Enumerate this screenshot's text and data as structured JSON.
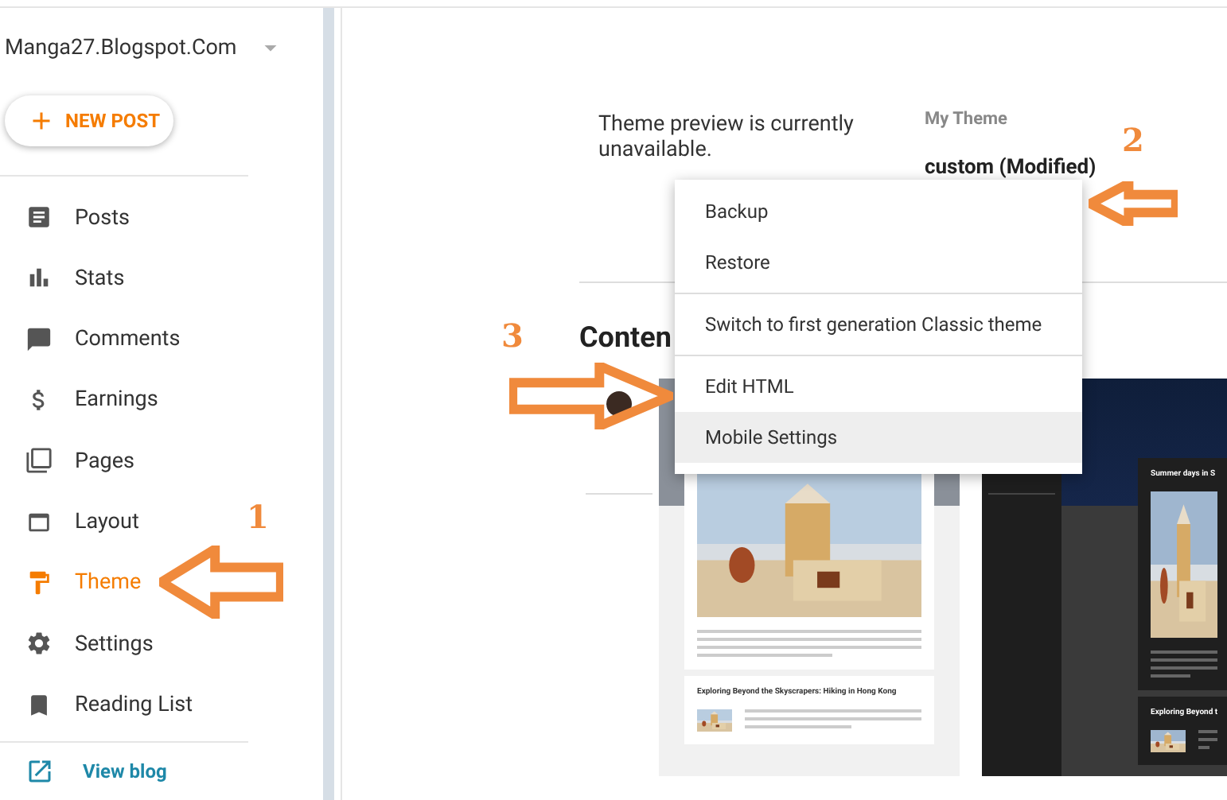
{
  "sidebar": {
    "blog_title": "Manga27.Blogspot.Com",
    "new_post": "NEW POST",
    "items": [
      {
        "label": "Posts",
        "selected": false
      },
      {
        "label": "Stats",
        "selected": false
      },
      {
        "label": "Comments",
        "selected": false
      },
      {
        "label": "Earnings",
        "selected": false
      },
      {
        "label": "Pages",
        "selected": false
      },
      {
        "label": "Layout",
        "selected": false
      },
      {
        "label": "Theme",
        "selected": true
      },
      {
        "label": "Settings",
        "selected": false
      },
      {
        "label": "Reading List",
        "selected": false
      }
    ],
    "view_blog": "View blog"
  },
  "main": {
    "preview_message": "Theme preview is currently unavailable.",
    "my_theme_label": "My Theme",
    "theme_name": "custom (Modified)",
    "section_heading": "Conten",
    "previews": [
      {
        "kind": "light",
        "headings": [
          "Exploring Beyond the Skyscrapers: Hiking in Hong Kong"
        ]
      },
      {
        "kind": "dark",
        "headings": [
          "Summer days in S",
          "Exploring Beyond t"
        ]
      }
    ]
  },
  "menu": {
    "groups": [
      [
        {
          "label": "Backup",
          "highlighted": false
        },
        {
          "label": "Restore",
          "highlighted": false
        }
      ],
      [
        {
          "label": "Switch to first generation Classic theme",
          "highlighted": false
        }
      ],
      [
        {
          "label": "Edit HTML",
          "highlighted": false
        },
        {
          "label": "Mobile Settings",
          "highlighted": true
        }
      ]
    ]
  },
  "annotations": [
    {
      "number": "1"
    },
    {
      "number": "2"
    },
    {
      "number": "3"
    }
  ]
}
